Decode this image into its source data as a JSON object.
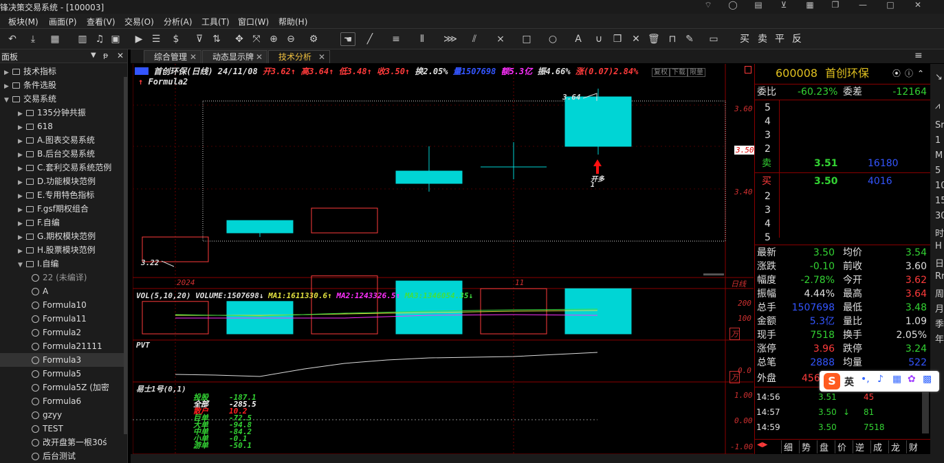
{
  "window": {
    "title": "锋决策交易系统 - [100003]"
  },
  "menu": [
    "板块(M)",
    "画面(P)",
    "查看(V)",
    "交易(O)",
    "分析(A)",
    "工具(T)",
    "窗口(W)",
    "帮助(H)"
  ],
  "toolbar": {
    "dollar": "$",
    "text_buttons": [
      "买",
      "卖",
      "平",
      "反"
    ]
  },
  "left_panel": {
    "title": "面板",
    "tree": [
      {
        "label": "技术指标",
        "type": "folder",
        "level": 0,
        "expanded": false
      },
      {
        "label": "条件选股",
        "type": "folder",
        "level": 0,
        "expanded": false
      },
      {
        "label": "交易系统",
        "type": "folder",
        "level": 0,
        "expanded": true
      },
      {
        "label": "135分钟共振",
        "type": "folder",
        "level": 1
      },
      {
        "label": "618",
        "type": "folder",
        "level": 1
      },
      {
        "label": "A.图表交易系统",
        "type": "folder",
        "level": 1
      },
      {
        "label": "B.后台交易系统",
        "type": "folder",
        "level": 1
      },
      {
        "label": "C.套利交易系统范例",
        "type": "folder",
        "level": 1
      },
      {
        "label": "D.功能模块范例",
        "type": "folder",
        "level": 1
      },
      {
        "label": "E.专用特色指标",
        "type": "folder",
        "level": 1
      },
      {
        "label": "F.gsf期权组合",
        "type": "folder",
        "level": 1
      },
      {
        "label": "F.自编",
        "type": "folder",
        "level": 1
      },
      {
        "label": "G.期权模块范例",
        "type": "folder",
        "level": 1
      },
      {
        "label": "H.股票模块范例",
        "type": "folder",
        "level": 1
      },
      {
        "label": "I.自编",
        "type": "folder",
        "level": 1,
        "expanded": true
      },
      {
        "label": "22 (未编译)",
        "type": "formula",
        "level": 2,
        "dim": true
      },
      {
        "label": "A",
        "type": "formula",
        "level": 2
      },
      {
        "label": "Formula10",
        "type": "formula",
        "level": 2
      },
      {
        "label": "Formula11",
        "type": "formula",
        "level": 2
      },
      {
        "label": "Formula2",
        "type": "formula",
        "level": 2
      },
      {
        "label": "Formula21111",
        "type": "formula",
        "level": 2
      },
      {
        "label": "Formula3",
        "type": "formula",
        "level": 2,
        "selected": true
      },
      {
        "label": "Formula5",
        "type": "formula",
        "level": 2
      },
      {
        "label": "Formula5Z (加密",
        "type": "formula",
        "level": 2
      },
      {
        "label": "Formula6",
        "type": "formula",
        "level": 2
      },
      {
        "label": "gzyy",
        "type": "formula",
        "level": 2
      },
      {
        "label": "TEST",
        "type": "formula",
        "level": 2
      },
      {
        "label": "改开盘第一根30ś",
        "type": "formula",
        "level": 2
      },
      {
        "label": "后台测试",
        "type": "formula",
        "level": 2
      }
    ]
  },
  "tabs": [
    {
      "label": "综合管理",
      "active": false
    },
    {
      "label": "动态显示牌",
      "active": false
    },
    {
      "label": "技术分析",
      "active": true
    }
  ],
  "chart": {
    "header": {
      "name": "首创环保(日线) 24/11/08",
      "open": "开3.62↑",
      "high": "高3.64↑",
      "low": "低3.48↑",
      "close": "收3.50↑",
      "turnover": "换2.05%",
      "volume": "量1507698",
      "amount": "额5.3亿",
      "amplitude": "振4.66%",
      "change": "涨(0.07)2.84%",
      "buttons": [
        "复权",
        "下载",
        "限量"
      ]
    },
    "formula_label": "Formula2",
    "hi_label": "3.64",
    "lo_label": "3.22",
    "signal_label": "开多",
    "signal_count": "1",
    "x_labels": [
      "2024",
      "11"
    ],
    "period_label": "日线",
    "price_ticks": [
      "3.60",
      "3.50",
      "3.40"
    ],
    "vol_header": {
      "name": "VOL(5,10,20)",
      "volume": "VOLUME:1507698↓",
      "ma1": "MA1:1611330.6↑",
      "ma2": "MA2:1243326.5↑",
      "ma3": "MA3:1346054.35↓"
    },
    "vol_ticks": [
      "200",
      "100",
      "万"
    ],
    "pvt_label": "PVT",
    "pvt_ticks": [
      "0.0",
      "万"
    ],
    "bs_header": "易士1号(0,1)",
    "bs_ticks": [
      "1.00",
      "0.00",
      "-1.00"
    ],
    "bs_rows": [
      {
        "label": "投股",
        "value": "-187.1",
        "color": "#33d333"
      },
      {
        "label": "全部",
        "value": "-285.5",
        "color": "#ffffff"
      },
      {
        "label": "散户",
        "value": "10.2",
        "color": "#ff2020"
      },
      {
        "label": "巨单",
        "value": "-72.5",
        "color": "#33d333"
      },
      {
        "label": "大单",
        "value": "-94.8",
        "color": "#33d333"
      },
      {
        "label": "中单",
        "value": "-84.2",
        "color": "#33d333"
      },
      {
        "label": "小单",
        "value": "-0.1",
        "color": "#33d333"
      },
      {
        "label": "游单",
        "value": "-50.1",
        "color": "#33d333"
      }
    ],
    "candles": [
      {
        "open": 3.22,
        "close": 3.28,
        "high": 3.28,
        "low": 3.22
      },
      {
        "open": 3.32,
        "close": 3.29,
        "high": 3.32,
        "low": 3.28
      },
      {
        "open": 3.29,
        "close": 3.35,
        "high": 3.35,
        "low": 3.29
      },
      {
        "open": 3.44,
        "close": 3.41,
        "high": 3.5,
        "low": 3.39
      },
      {
        "open": 3.45,
        "close": 3.45,
        "high": 3.51,
        "low": 3.42
      },
      {
        "open": 3.62,
        "close": 3.5,
        "high": 3.64,
        "low": 3.48
      }
    ],
    "volumes": [
      100,
      100,
      200,
      180,
      150,
      150
    ]
  },
  "quote": {
    "code": "600008",
    "name": "首创环保",
    "weibi_label": "委比",
    "weibi": "-60.23%",
    "weicha_label": "委差",
    "weicha": "-12164",
    "sell_levels": [
      "5",
      "4",
      "3",
      "2"
    ],
    "sell1": {
      "label": "卖",
      "price": "3.51",
      "vol": "16180"
    },
    "buy1": {
      "label": "买",
      "price": "3.50",
      "vol": "4016"
    },
    "buy_levels": [
      "2",
      "3",
      "4",
      "5"
    ],
    "stats": [
      {
        "l1": "最新",
        "v1": "3.50",
        "c1": "green",
        "l2": "均价",
        "v2": "3.54",
        "c2": "green"
      },
      {
        "l1": "涨跌",
        "v1": "-0.10",
        "c1": "green",
        "l2": "前收",
        "v2": "3.60",
        "c2": "white"
      },
      {
        "l1": "幅度",
        "v1": "-2.78%",
        "c1": "green",
        "l2": "今开",
        "v2": "3.62",
        "c2": "red"
      },
      {
        "l1": "振幅",
        "v1": "4.44%",
        "c1": "white",
        "l2": "最高",
        "v2": "3.64",
        "c2": "red"
      },
      {
        "l1": "总手",
        "v1": "1507698",
        "c1": "blue",
        "l2": "最低",
        "v2": "3.48",
        "c2": "green"
      },
      {
        "l1": "金额",
        "v1": "5.3亿",
        "c1": "blue",
        "l2": "量比",
        "v2": "1.09",
        "c2": "white"
      },
      {
        "l1": "现手",
        "v1": "7518",
        "c1": "green",
        "l2": "换手",
        "v2": "2.05%",
        "c2": "white"
      },
      {
        "l1": "涨停",
        "v1": "3.96",
        "c1": "red",
        "l2": "跌停",
        "v2": "3.24",
        "c2": "green"
      },
      {
        "l1": "总笔",
        "v1": "2888",
        "c1": "blue",
        "l2": "均量",
        "v2": "522",
        "c2": "blue"
      }
    ],
    "outer_label": "外盘",
    "outer_value": "456",
    "ticks": [
      {
        "time": "14:56",
        "price": "3.51",
        "arrow": "",
        "vol": "45",
        "vc": "red"
      },
      {
        "time": "14:57",
        "price": "3.50",
        "arrow": "↓",
        "vol": "81",
        "vc": "green"
      },
      {
        "time": "14:59",
        "price": "3.50",
        "arrow": "",
        "vol": "7518",
        "vc": "green"
      }
    ],
    "bottom_tabs": [
      "细",
      "势",
      "盘",
      "价",
      "逆",
      "成",
      "龙",
      "财"
    ]
  },
  "far_right": [
    "Sr",
    "1",
    "M",
    "5",
    "10",
    "15",
    "30",
    "时",
    "H",
    "日",
    "Rr",
    "周",
    "月",
    "季",
    "年"
  ],
  "ime": {
    "brand": "S",
    "lang": "英"
  },
  "colors": {
    "bull": "#ff3b3b",
    "bear": "#00d5d5",
    "axis": "#8b0000"
  }
}
